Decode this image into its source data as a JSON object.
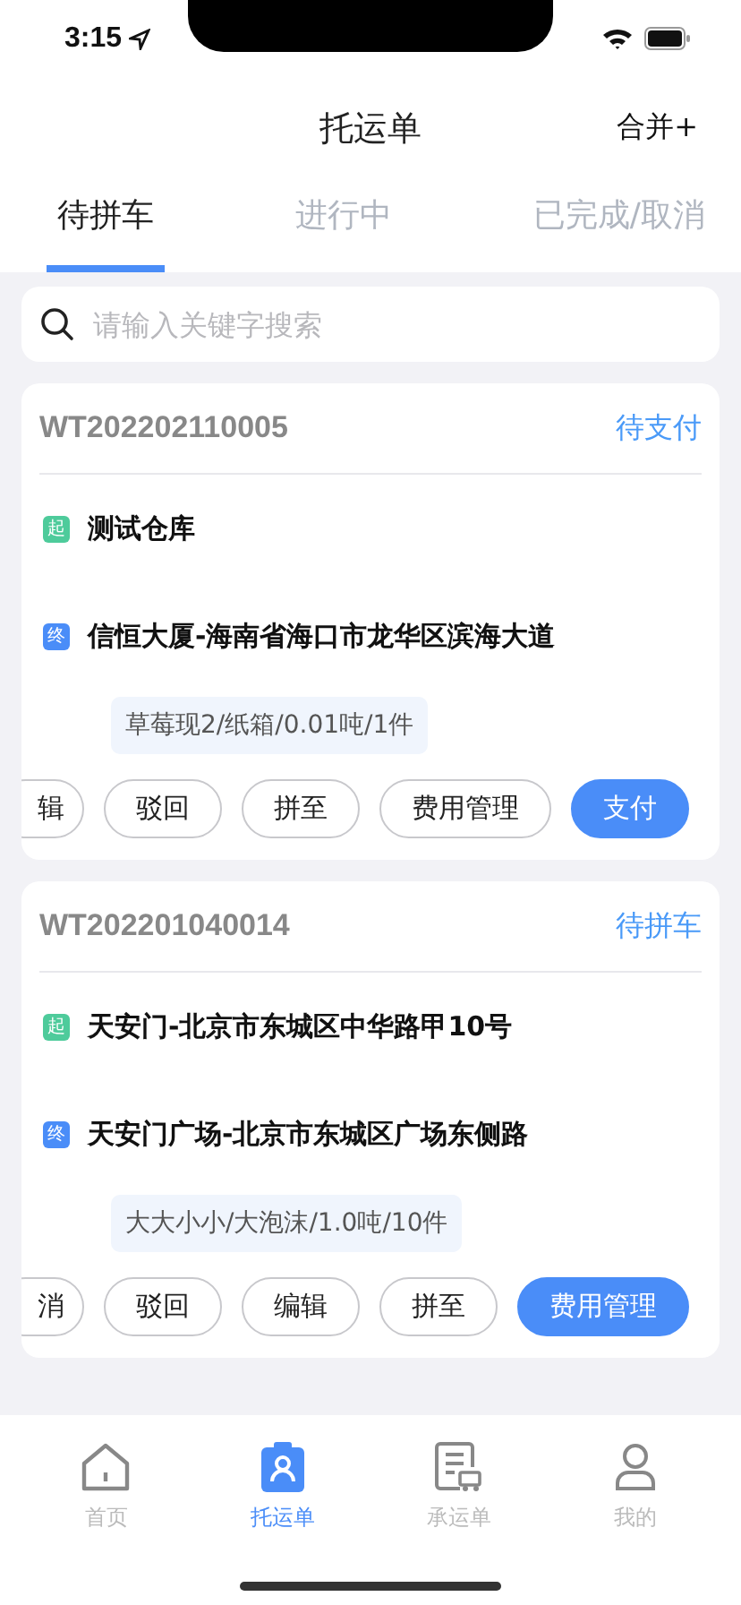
{
  "status_bar": {
    "time": "3:15"
  },
  "header": {
    "title": "托运单",
    "action": "合并+"
  },
  "tabs": [
    {
      "label": "待拼车",
      "selected": true
    },
    {
      "label": "进行中",
      "selected": false
    },
    {
      "label": "已完成/取消",
      "selected": false
    }
  ],
  "search": {
    "placeholder": "请输入关键字搜索"
  },
  "orders": [
    {
      "number": "WT202202110005",
      "status": "待支付",
      "start_badge": "起",
      "start": "测试仓库",
      "end_badge": "终",
      "end": "信恒大厦-海南省海口市龙华区滨海大道",
      "goods": "草莓现2/纸箱/0.01吨/1件",
      "actions": [
        {
          "label": "辑",
          "kind": "cut"
        },
        {
          "label": "驳回",
          "kind": "outline"
        },
        {
          "label": "拼至",
          "kind": "outline"
        },
        {
          "label": "费用管理",
          "kind": "outline"
        },
        {
          "label": "支付",
          "kind": "primary"
        }
      ]
    },
    {
      "number": "WT202201040014",
      "status": "待拼车",
      "start_badge": "起",
      "start": "天安门-北京市东城区中华路甲10号",
      "end_badge": "终",
      "end": "天安门广场-北京市东城区广场东侧路",
      "goods": "大大小小/大泡沫/1.0吨/10件",
      "actions": [
        {
          "label": "消",
          "kind": "cut"
        },
        {
          "label": "驳回",
          "kind": "outline"
        },
        {
          "label": "编辑",
          "kind": "outline"
        },
        {
          "label": "拼至",
          "kind": "outline"
        },
        {
          "label": "费用管理",
          "kind": "primary"
        }
      ]
    }
  ],
  "tab_bar": [
    {
      "label": "首页",
      "kind": "home",
      "selected": false
    },
    {
      "label": "托运单",
      "kind": "clipboard",
      "selected": true
    },
    {
      "label": "承运单",
      "kind": "document",
      "selected": false
    },
    {
      "label": "我的",
      "kind": "person",
      "selected": false
    }
  ]
}
